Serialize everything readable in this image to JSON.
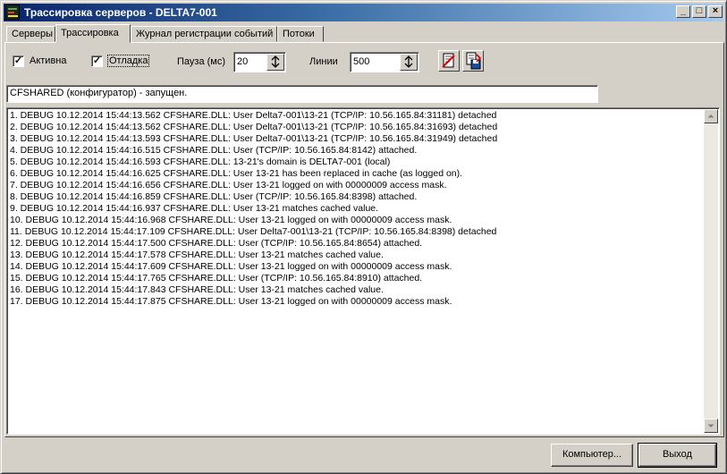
{
  "window": {
    "title": "Трассировка серверов - DELTA7-001",
    "min_glyph": "_",
    "max_glyph": "□",
    "close_glyph": "×"
  },
  "tabs": [
    {
      "label": "Серверы"
    },
    {
      "label": "Трассировка"
    },
    {
      "label": "Журнал регистрации событий"
    },
    {
      "label": "Потоки"
    }
  ],
  "toolbar": {
    "active_label": "Активна",
    "active_checked": true,
    "debug_label": "Отладка",
    "debug_checked": true,
    "check_glyph": "✓",
    "pause_label": "Пауза (мс)",
    "pause_value": "20",
    "lines_label": "Линии",
    "lines_value": "500",
    "clear_icon": "clear-log-icon",
    "save_icon": "save-log-icon"
  },
  "status": "CFSHARED (конфигуратор)  - запущен.",
  "log": [
    "1. DEBUG  10.12.2014  15:44:13.562 CFSHARE.DLL: User Delta7-001\\13-21 (TCP/IP: 10.56.165.84:31181) detached",
    "2. DEBUG  10.12.2014  15:44:13.562 CFSHARE.DLL: User Delta7-001\\13-21 (TCP/IP: 10.56.165.84:31693) detached",
    "3. DEBUG  10.12.2014  15:44:13.593 CFSHARE.DLL: User Delta7-001\\13-21 (TCP/IP: 10.56.165.84:31949) detached",
    "4. DEBUG  10.12.2014  15:44:16.515 CFSHARE.DLL: User  (TCP/IP: 10.56.165.84:8142) attached.",
    "5. DEBUG  10.12.2014  15:44:16.593 CFSHARE.DLL: 13-21's domain is DELTA7-001 (local)",
    "6. DEBUG  10.12.2014  15:44:16.625 CFSHARE.DLL: User 13-21 has been replaced in cache (as logged on).",
    "7. DEBUG  10.12.2014  15:44:16.656 CFSHARE.DLL: User 13-21 logged on with 00000009 access mask.",
    "8. DEBUG  10.12.2014  15:44:16.859 CFSHARE.DLL: User  (TCP/IP: 10.56.165.84:8398) attached.",
    "9. DEBUG  10.12.2014  15:44:16.937 CFSHARE.DLL: User 13-21 matches cached value.",
    "10. DEBUG  10.12.2014  15:44:16.968 CFSHARE.DLL: User 13-21 logged on with 00000009 access mask.",
    "11. DEBUG  10.12.2014  15:44:17.109 CFSHARE.DLL: User Delta7-001\\13-21 (TCP/IP: 10.56.165.84:8398) detached",
    "12. DEBUG  10.12.2014  15:44:17.500 CFSHARE.DLL: User  (TCP/IP: 10.56.165.84:8654) attached.",
    "13. DEBUG  10.12.2014  15:44:17.578 CFSHARE.DLL: User 13-21 matches cached value.",
    "14. DEBUG  10.12.2014  15:44:17.609 CFSHARE.DLL: User 13-21 logged on with 00000009 access mask.",
    "15. DEBUG  10.12.2014  15:44:17.765 CFSHARE.DLL: User  (TCP/IP: 10.56.165.84:8910) attached.",
    "16. DEBUG  10.12.2014  15:44:17.843 CFSHARE.DLL: User 13-21 matches cached value.",
    "17. DEBUG  10.12.2014  15:44:17.875 CFSHARE.DLL: User 13-21 logged on with 00000009 access mask."
  ],
  "buttons": {
    "computer_label": "Компьютер...",
    "exit_label": "Выход"
  }
}
